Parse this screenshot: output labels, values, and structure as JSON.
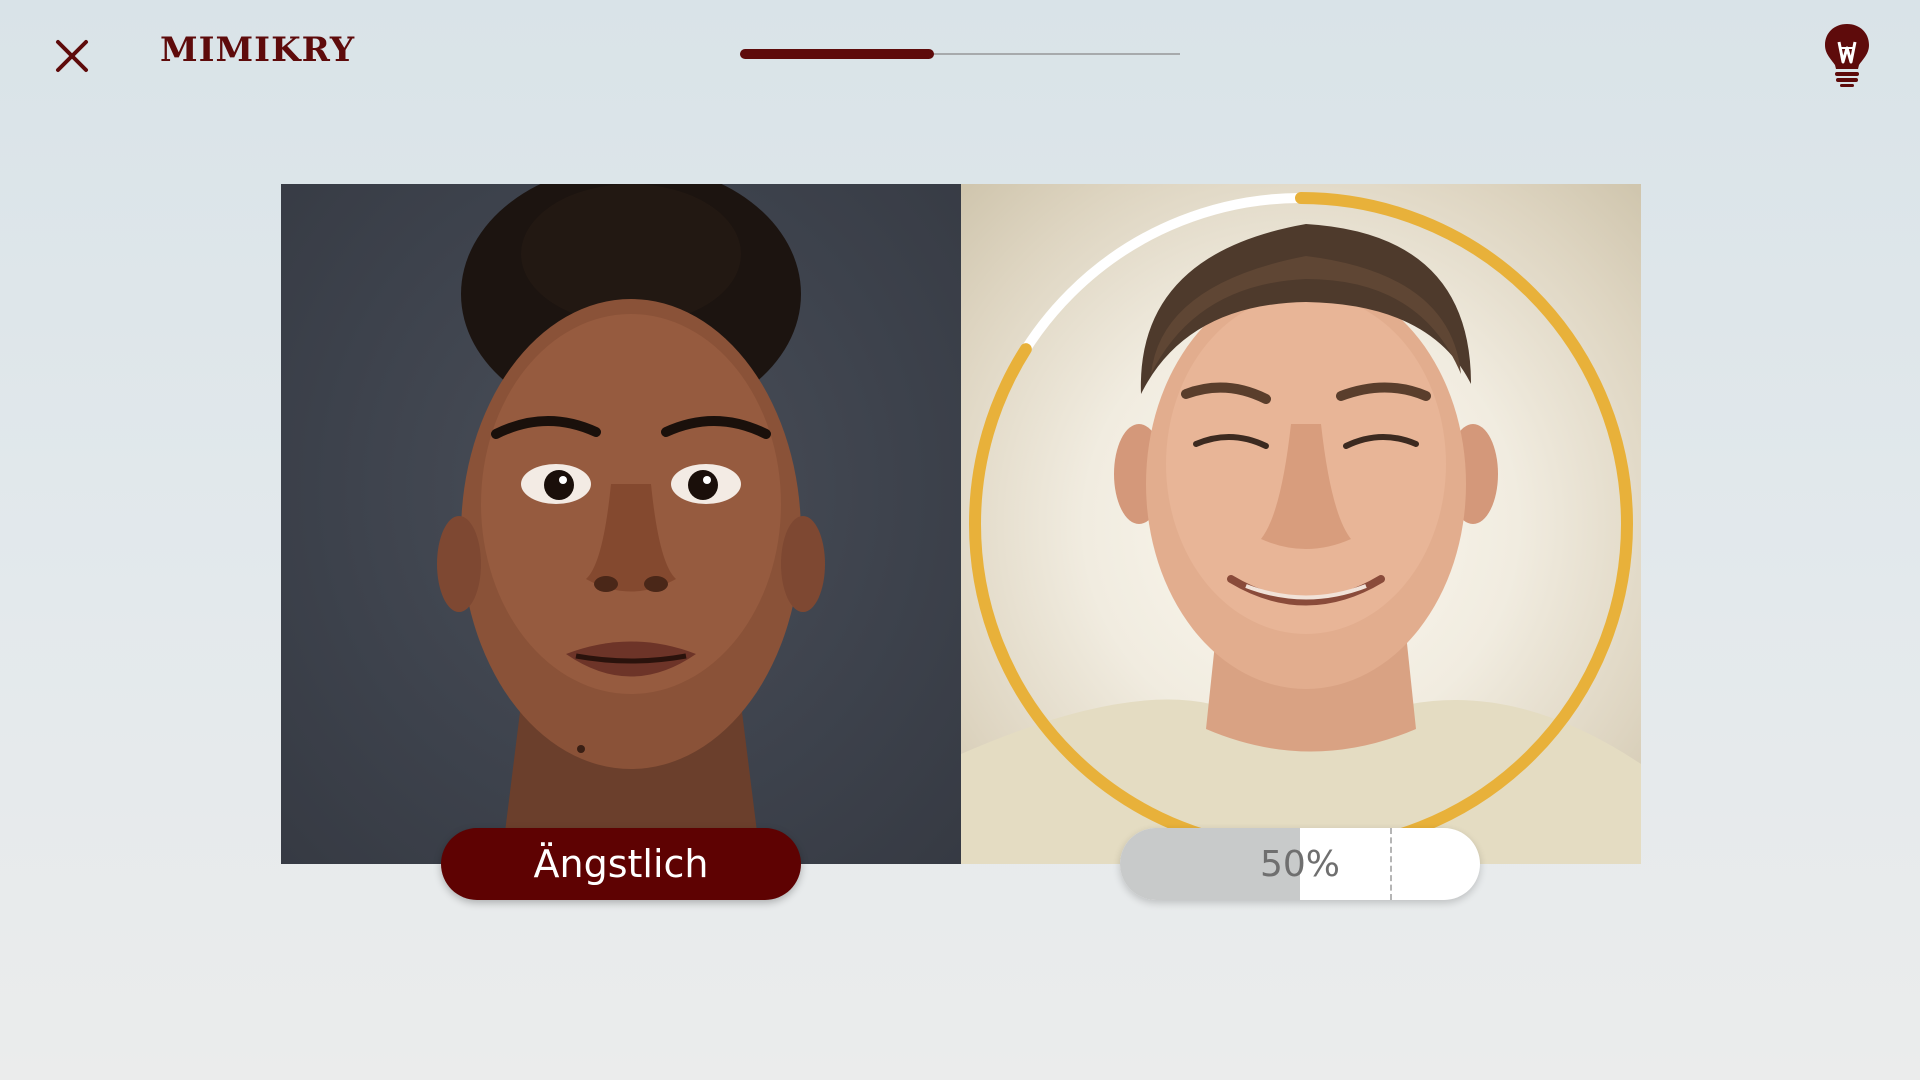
{
  "header": {
    "title": "MIMIKRY",
    "close_icon": "close-icon",
    "hint_icon": "lightbulb-icon",
    "lesson_progress": 0.44
  },
  "target": {
    "emotion_label": "Ängstlich"
  },
  "mirror": {
    "score_text": "50%",
    "score_value": 0.5,
    "target_marker": 0.75,
    "ring_progress": 0.84
  },
  "colors": {
    "brand": "#5e0b0b",
    "ring_accent": "#e8b13a",
    "pill_fill": "#c8caca"
  }
}
